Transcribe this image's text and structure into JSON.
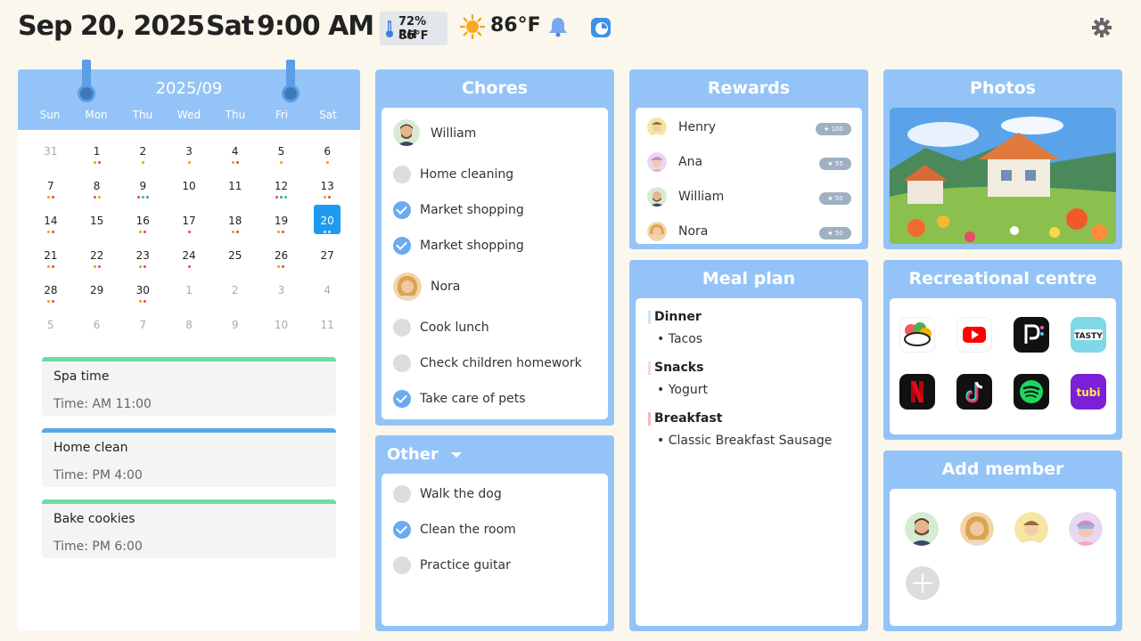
{
  "header": {
    "date": "Sep 20, 2025",
    "weekday": "Sat",
    "time": "9:00 AM",
    "humidity": "72% RH",
    "indoor_temp": "86°F",
    "outdoor_temp": "86°F"
  },
  "calendar": {
    "month": "2025/09",
    "weekdays": [
      "Sun",
      "Mon",
      "Thu",
      "Wed",
      "Thu",
      "Fri",
      "Sat"
    ],
    "weeks": [
      [
        "31",
        "1",
        "2",
        "3",
        "4",
        "5",
        "6"
      ],
      [
        "7",
        "8",
        "9",
        "10",
        "11",
        "12",
        "13"
      ],
      [
        "14",
        "15",
        "16",
        "17",
        "18",
        "19",
        "20"
      ],
      [
        "21",
        "22",
        "23",
        "24",
        "25",
        "26",
        "27"
      ],
      [
        "28",
        "29",
        "30",
        "1",
        "2",
        "3",
        "4"
      ],
      [
        "5",
        "6",
        "7",
        "8",
        "9",
        "10",
        "11"
      ]
    ],
    "selected": "20",
    "events": [
      {
        "title": "Spa time",
        "time": "Time: AM 11:00",
        "color": "#6edc9f"
      },
      {
        "title": "Home clean",
        "time": "Time: PM 4:00",
        "color": "#5aa6e0"
      },
      {
        "title": "Bake cookies",
        "time": "Time: PM 6:00",
        "color": "#6edc9f"
      }
    ]
  },
  "chores": {
    "title": "Chores",
    "members": [
      {
        "name": "William",
        "tasks": [
          {
            "label": "Home cleaning",
            "done": false
          },
          {
            "label": "Market shopping",
            "done": true
          },
          {
            "label": "Market shopping",
            "done": true
          }
        ]
      },
      {
        "name": "Nora",
        "tasks": [
          {
            "label": "Cook lunch",
            "done": false
          },
          {
            "label": "Check children homework",
            "done": false
          },
          {
            "label": "Take care of pets",
            "done": true
          }
        ]
      }
    ]
  },
  "other": {
    "title": "Other",
    "tasks": [
      {
        "label": "Walk the dog",
        "done": false
      },
      {
        "label": "Clean the room",
        "done": true
      },
      {
        "label": "Practice guitar",
        "done": false
      }
    ]
  },
  "rewards": {
    "title": "Rewards",
    "people": [
      {
        "name": "Henry",
        "points": "100"
      },
      {
        "name": "Ana",
        "points": "55"
      },
      {
        "name": "William",
        "points": "50"
      },
      {
        "name": "Nora",
        "points": "50"
      }
    ]
  },
  "meal_plan": {
    "title": "Meal plan",
    "sections": [
      {
        "name": "Dinner",
        "item": "• Tacos",
        "color": "#c9e6fb"
      },
      {
        "name": "Snacks",
        "item": "• Yogurt",
        "color": "#f6d6e6"
      },
      {
        "name": "Breakfast",
        "item": "• Classic Breakfast Sausage",
        "color": "#f4b8b8"
      }
    ]
  },
  "photos": {
    "title": "Photos"
  },
  "recreational": {
    "title": "Recreational centre",
    "apps": [
      "kids-app-icon",
      "youtube-icon",
      "pocket-fm-icon",
      "tasty-icon",
      "netflix-icon",
      "tiktok-icon",
      "spotify-icon",
      "tubi-icon"
    ]
  },
  "add_member": {
    "title": "Add member"
  }
}
